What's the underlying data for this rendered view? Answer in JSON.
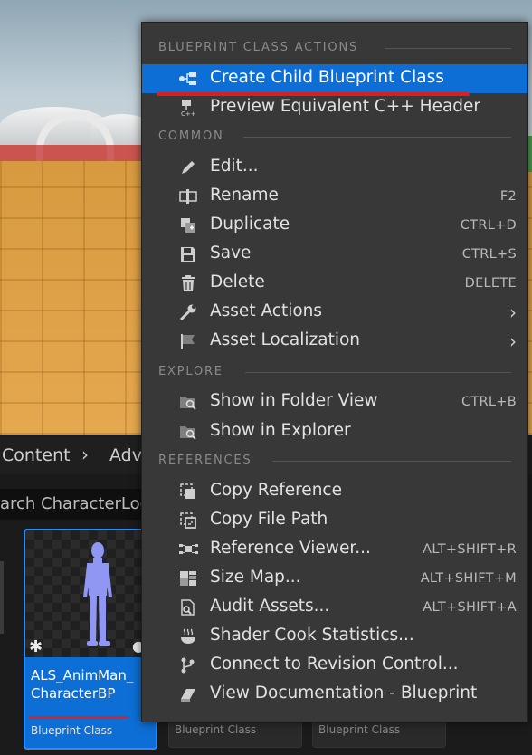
{
  "breadcrumb": {
    "root": "Content",
    "next": "Adv"
  },
  "search": {
    "value": "arch CharacterLog"
  },
  "assets": [
    {
      "name": "ALS_AnimMan_ CharacterBP",
      "type": "Blueprint Class",
      "selected": true
    },
    {
      "name": "",
      "type": "Blueprint Class",
      "selected": false
    },
    {
      "name": "",
      "type": "Blueprint Class",
      "selected": false
    }
  ],
  "menu": {
    "sections": [
      {
        "title": "BLUEPRINT CLASS ACTIONS",
        "items": [
          {
            "label": "Create Child Blueprint Class",
            "shortcut": "",
            "icon": "blueprint-child-icon",
            "active": true
          },
          {
            "label": "Preview Equivalent C++ Header",
            "shortcut": "",
            "icon": "cpp-header-icon"
          }
        ]
      },
      {
        "title": "COMMON",
        "items": [
          {
            "label": "Edit...",
            "shortcut": "",
            "icon": "pencil-icon"
          },
          {
            "label": "Rename",
            "shortcut": "F2",
            "icon": "rename-icon"
          },
          {
            "label": "Duplicate",
            "shortcut": "CTRL+D",
            "icon": "duplicate-icon"
          },
          {
            "label": "Save",
            "shortcut": "CTRL+S",
            "icon": "save-icon"
          },
          {
            "label": "Delete",
            "shortcut": "DELETE",
            "icon": "trash-icon"
          },
          {
            "label": "Asset Actions",
            "shortcut": "",
            "icon": "wrench-icon",
            "submenu": true
          },
          {
            "label": "Asset Localization",
            "shortcut": "",
            "icon": "flag-icon",
            "submenu": true
          }
        ]
      },
      {
        "title": "EXPLORE",
        "items": [
          {
            "label": "Show in Folder View",
            "shortcut": "CTRL+B",
            "icon": "folder-search-icon"
          },
          {
            "label": "Show in Explorer",
            "shortcut": "",
            "icon": "folder-search-icon"
          }
        ]
      },
      {
        "title": "REFERENCES",
        "items": [
          {
            "label": "Copy Reference",
            "shortcut": "",
            "icon": "copy-reference-icon"
          },
          {
            "label": "Copy File Path",
            "shortcut": "",
            "icon": "copy-path-icon"
          },
          {
            "label": "Reference Viewer...",
            "shortcut": "ALT+SHIFT+R",
            "icon": "reference-viewer-icon"
          },
          {
            "label": "Size Map...",
            "shortcut": "ALT+SHIFT+M",
            "icon": "size-map-icon"
          },
          {
            "label": "Audit Assets...",
            "shortcut": "ALT+SHIFT+A",
            "icon": "audit-icon"
          },
          {
            "label": "Shader Cook Statistics...",
            "shortcut": "",
            "icon": "shader-steam-icon"
          },
          {
            "label": "Connect to Revision Control...",
            "shortcut": "",
            "icon": "revision-branch-icon"
          },
          {
            "label": "View Documentation - Blueprint",
            "shortcut": "",
            "icon": "book-icon"
          }
        ]
      }
    ]
  },
  "colors": {
    "accent": "#0d6fd6",
    "menu_bg": "#383838",
    "highlight_underline": "#d72020"
  }
}
